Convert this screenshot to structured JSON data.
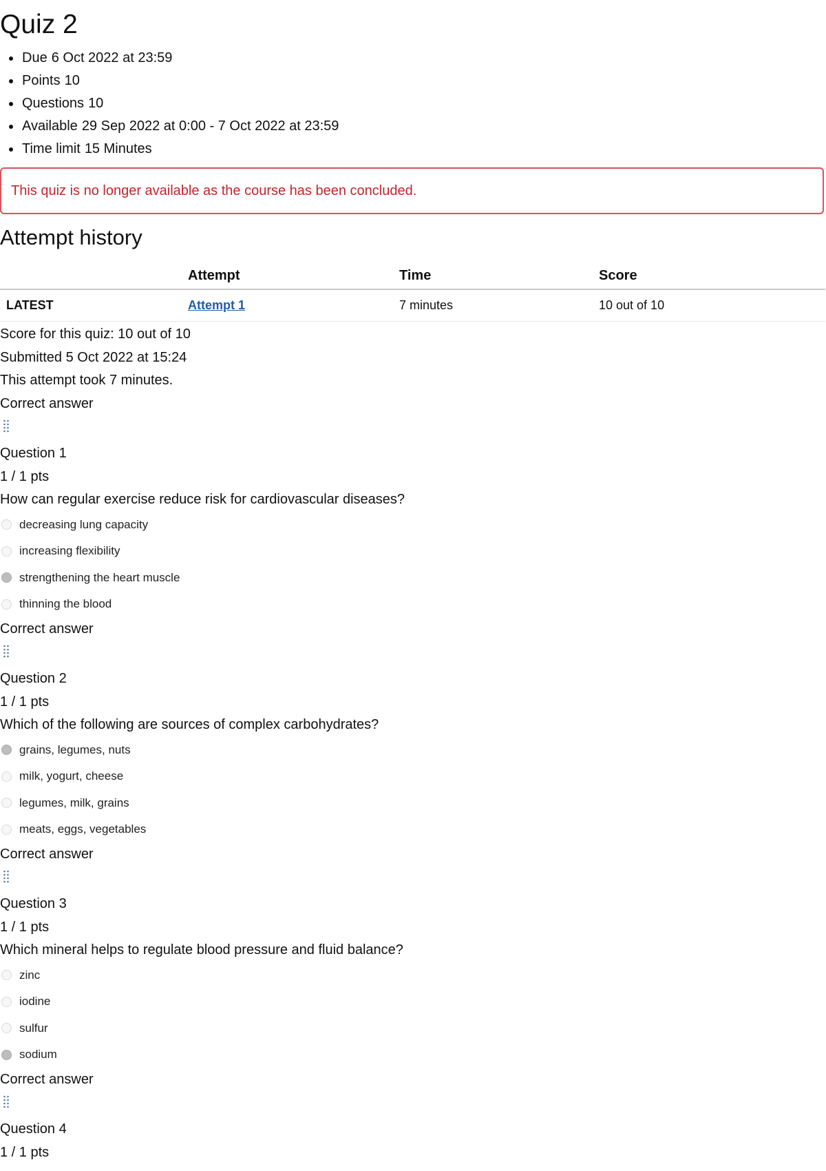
{
  "quiz": {
    "title": "Quiz 2",
    "details": [
      {
        "label": "Due",
        "value": "6 Oct 2022 at 23:59"
      },
      {
        "label": "Points",
        "value": "10"
      },
      {
        "label": "Questions",
        "value": "10"
      },
      {
        "label": "Available",
        "value": "29 Sep 2022 at 0:00 - 7 Oct 2022 at 23:59"
      },
      {
        "label": "Time limit",
        "value": "15 Minutes"
      }
    ],
    "alert": "This quiz is no longer available as the course has been concluded.",
    "alert_color": "#c4242f"
  },
  "history": {
    "title": "Attempt history",
    "columns": [
      "",
      "Attempt",
      "Time",
      "Score"
    ],
    "rows": [
      {
        "tag": "LATEST",
        "attempt": "Attempt 1",
        "time": "7 minutes",
        "score": "10 out of 10"
      }
    ]
  },
  "summary": {
    "score": "Score for this quiz: 10 out of 10",
    "submitted": "Submitted 5 Oct 2022 at 15:24",
    "duration": "This attempt took 7 minutes."
  },
  "questions": [
    {
      "status": "Correct answer",
      "title": "Question 1",
      "points": "1 / 1 pts",
      "text": "How can regular exercise reduce risk for cardiovascular diseases?",
      "answers": [
        "decreasing lung capacity",
        "increasing flexibility",
        "strengthening the heart muscle",
        "thinning the blood"
      ],
      "selected_index": 2
    },
    {
      "status": "Correct answer",
      "title": "Question 2",
      "points": "1 / 1 pts",
      "text": "Which of the following are sources of complex carbohydrates?",
      "answers": [
        "grains, legumes, nuts",
        "milk, yogurt, cheese",
        "legumes, milk, grains",
        "meats, eggs, vegetables"
      ],
      "selected_index": 0
    },
    {
      "status": "Correct answer",
      "title": "Question 3",
      "points": "1 / 1 pts",
      "text": "Which mineral helps to regulate blood pressure and fluid balance?",
      "answers": [
        "zinc",
        "iodine",
        "sulfur",
        "sodium"
      ],
      "selected_index": 3
    },
    {
      "status": "Correct answer",
      "title": "Question 4",
      "points": "1 / 1 pts"
    }
  ],
  "icons": {
    "drag_handle": "drag-handle-icon",
    "radio": "radio-button"
  },
  "colors": {
    "link": "#1f5fa8",
    "alert_border": "#d9535a",
    "handle": "#5b7fa6"
  }
}
